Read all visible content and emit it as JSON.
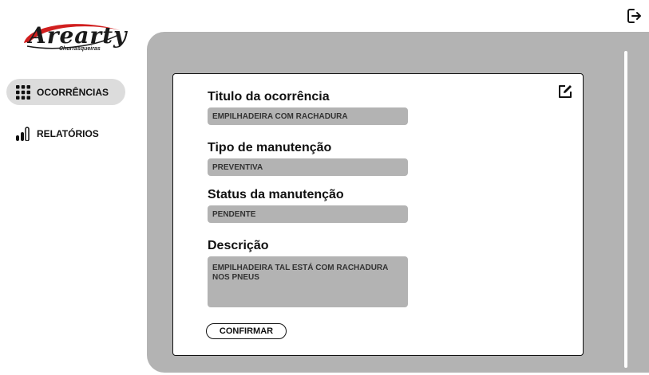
{
  "logo": {
    "brand": "Arearty",
    "sub": "Churrasqueiras",
    "accent_color": "#d11f1f"
  },
  "header": {
    "logout_icon": "logout-icon"
  },
  "sidebar": {
    "items": [
      {
        "label": "OCORRÊNCIAS",
        "icon": "grid-icon",
        "active": true
      },
      {
        "label": "RELATÓRIOS",
        "icon": "bar-chart-icon",
        "active": false
      }
    ]
  },
  "form": {
    "edit_icon": "edit-icon",
    "fields": [
      {
        "label": "Titulo da ocorrência",
        "value": "EMPILHADEIRA COM RACHADURA"
      },
      {
        "label": "Tipo de manutenção",
        "value": "PREVENTIVA"
      },
      {
        "label": "Status da manutenção",
        "value": "PENDENTE"
      },
      {
        "label": "Descrição",
        "value": "EMPILHADEIRA TAL ESTÁ COM RACHADURA\nNOS PNEUS"
      }
    ],
    "confirm_label": "CONFIRMAR"
  },
  "colors": {
    "panel": "#b3b3b3",
    "active_nav": "#dcdcdc",
    "field_bg": "#b3b3b3"
  }
}
